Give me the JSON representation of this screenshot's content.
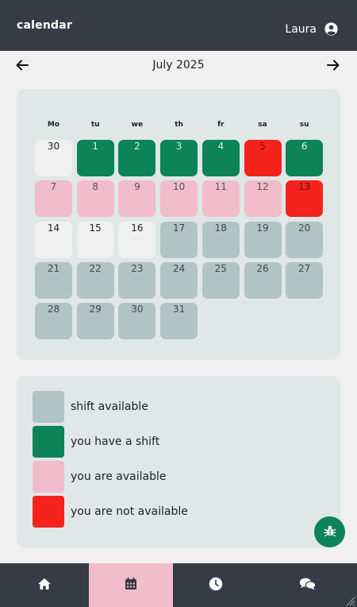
{
  "header": {
    "title": "calendar",
    "user_name": "Laura",
    "user_icon": "user-circle-icon"
  },
  "month_nav": {
    "title": "July 2025",
    "prev_icon": "arrow-left-icon",
    "next_icon": "arrow-right-icon"
  },
  "weekdays": [
    "Mo",
    "tu",
    "we",
    "th",
    "fr",
    "sa",
    "su"
  ],
  "weeks": [
    [
      {
        "day": "30",
        "status": "other-month"
      },
      {
        "day": "1",
        "status": "have-shift"
      },
      {
        "day": "2",
        "status": "have-shift"
      },
      {
        "day": "3",
        "status": "have-shift"
      },
      {
        "day": "4",
        "status": "have-shift"
      },
      {
        "day": "5",
        "status": "not-avail"
      },
      {
        "day": "6",
        "status": "have-shift"
      }
    ],
    [
      {
        "day": "7",
        "status": "you-avail"
      },
      {
        "day": "8",
        "status": "you-avail"
      },
      {
        "day": "9",
        "status": "you-avail"
      },
      {
        "day": "10",
        "status": "you-avail"
      },
      {
        "day": "11",
        "status": "you-avail"
      },
      {
        "day": "12",
        "status": "you-avail"
      },
      {
        "day": "13",
        "status": "not-avail"
      }
    ],
    [
      {
        "day": "14",
        "status": "empty"
      },
      {
        "day": "15",
        "status": "empty"
      },
      {
        "day": "16",
        "status": "empty"
      },
      {
        "day": "17",
        "status": "avail-shift"
      },
      {
        "day": "18",
        "status": "avail-shift"
      },
      {
        "day": "19",
        "status": "avail-shift"
      },
      {
        "day": "20",
        "status": "avail-shift"
      }
    ],
    [
      {
        "day": "21",
        "status": "avail-shift"
      },
      {
        "day": "22",
        "status": "avail-shift"
      },
      {
        "day": "23",
        "status": "avail-shift"
      },
      {
        "day": "24",
        "status": "avail-shift"
      },
      {
        "day": "25",
        "status": "avail-shift"
      },
      {
        "day": "26",
        "status": "avail-shift"
      },
      {
        "day": "27",
        "status": "avail-shift"
      }
    ],
    [
      {
        "day": "28",
        "status": "avail-shift"
      },
      {
        "day": "29",
        "status": "avail-shift"
      },
      {
        "day": "30",
        "status": "avail-shift"
      },
      {
        "day": "31",
        "status": "avail-shift"
      }
    ]
  ],
  "legend": [
    {
      "label": "shift available",
      "color": "#b2c3c4"
    },
    {
      "label": "you have a shift",
      "color": "#0c8359"
    },
    {
      "label": "you are available",
      "color": "#f1bccb"
    },
    {
      "label": "you are not available",
      "color": "#f5231b"
    }
  ],
  "bug_button_icon": "bug-icon",
  "bottom_nav": [
    {
      "name": "home",
      "icon": "home-icon",
      "active": false
    },
    {
      "name": "calendar",
      "icon": "calendar-icon",
      "active": true
    },
    {
      "name": "clock",
      "icon": "clock-icon",
      "active": false
    },
    {
      "name": "chat",
      "icon": "chat-icon",
      "active": false
    }
  ],
  "colors": {
    "topbar": "#373b45",
    "card": "#dfe7e7",
    "shift_available": "#b2c3c4",
    "have_shift": "#0c8359",
    "you_available": "#f1bccb",
    "not_available": "#f5231b"
  }
}
